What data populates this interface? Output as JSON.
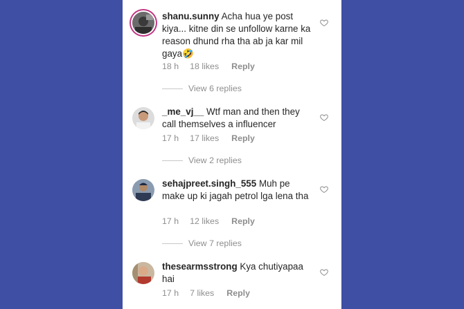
{
  "comments": [
    {
      "username": "shanu.sunny",
      "text": "Acha hua ye post kiya... kitne din se unfollow karne ka reason dhund rha tha ab ja kar mil gaya",
      "emoji": "🤣",
      "time": "18 h",
      "likes": "18 likes",
      "reply": "Reply",
      "view_replies": "View 6 replies"
    },
    {
      "username": "_me_vj__",
      "text": "Wtf man and then they call themselves a influencer",
      "time": "17 h",
      "likes": "17 likes",
      "reply": "Reply",
      "view_replies": "View 2 replies"
    },
    {
      "username": "sehajpreet.singh_555",
      "text": "Muh pe make up ki jagah petrol lga lena tha",
      "time": "17 h",
      "likes": "12 likes",
      "reply": "Reply",
      "view_replies": "View 7 replies"
    },
    {
      "username": "thesearmsstrong",
      "text": "Kya chutiyapaa hai",
      "time": "17 h",
      "likes": "7 likes",
      "reply": "Reply"
    }
  ],
  "colors": {
    "background": "#3f4fa3",
    "panel": "#ffffff",
    "text": "#262626",
    "muted": "#8e8e8e",
    "story_ring": "#c13584"
  },
  "icons": {
    "like": "heart-outline-icon"
  }
}
